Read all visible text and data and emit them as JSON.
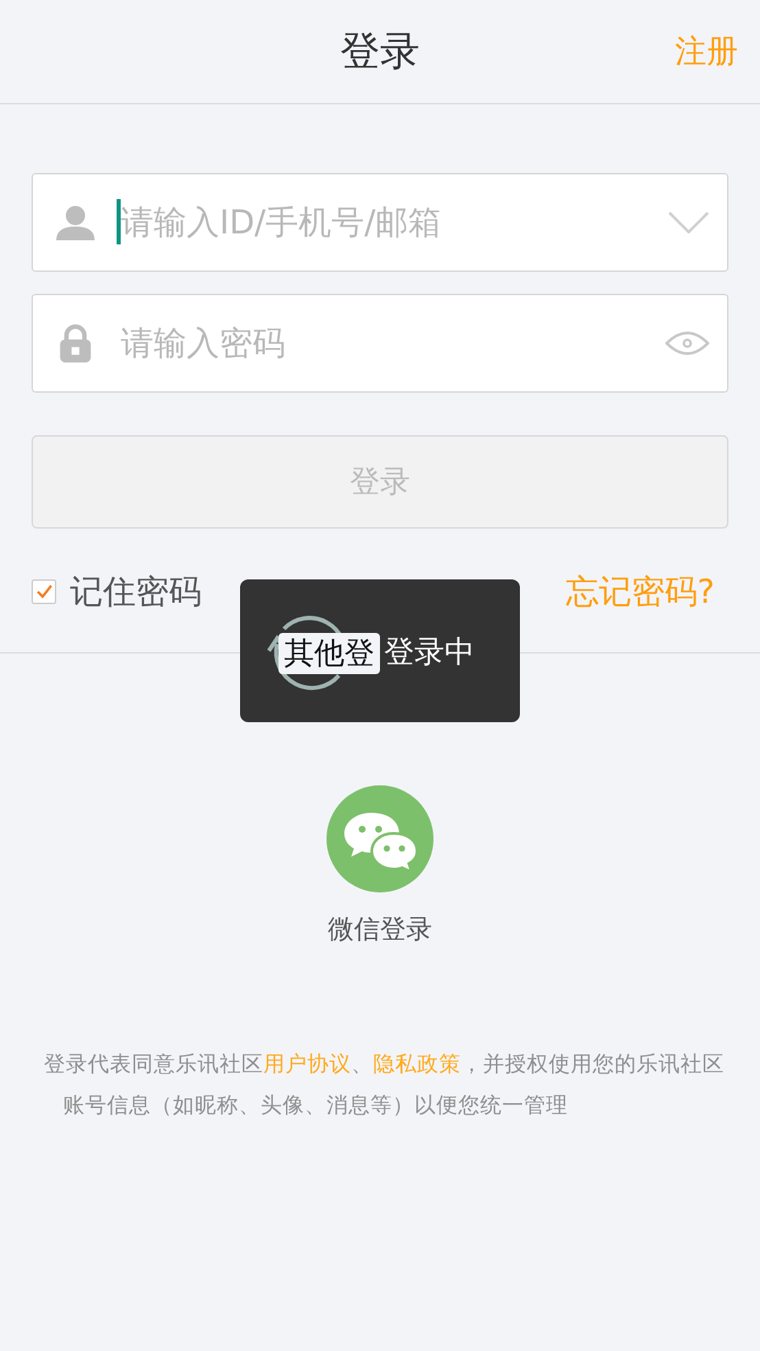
{
  "header": {
    "title": "登录",
    "register_link": "注册"
  },
  "username_field": {
    "placeholder": "请输入ID/手机号/邮箱",
    "focused": true
  },
  "password_field": {
    "placeholder": "请输入密码"
  },
  "login_button": {
    "label": "登录",
    "disabled": true
  },
  "remember": {
    "label": "记住密码",
    "checked": true
  },
  "forgot_link": "忘记密码?",
  "divider_label": "其他登",
  "toast": {
    "text": "登录中"
  },
  "social": [
    {
      "label": "微信登录"
    }
  ],
  "footer": {
    "lines": [
      [
        {
          "kind": "plain",
          "text": "登录代表同意乐讯社区"
        },
        {
          "kind": "link",
          "text": "用户协议"
        },
        {
          "kind": "plain",
          "text": "、"
        },
        {
          "kind": "link",
          "text": "隐私政策"
        },
        {
          "kind": "plain",
          "text": "，并授权使用您的乐讯社区"
        }
      ],
      [
        {
          "kind": "plain",
          "text": "账号信息（如昵称、头像、消息等）以便您统一管理"
        }
      ]
    ]
  }
}
